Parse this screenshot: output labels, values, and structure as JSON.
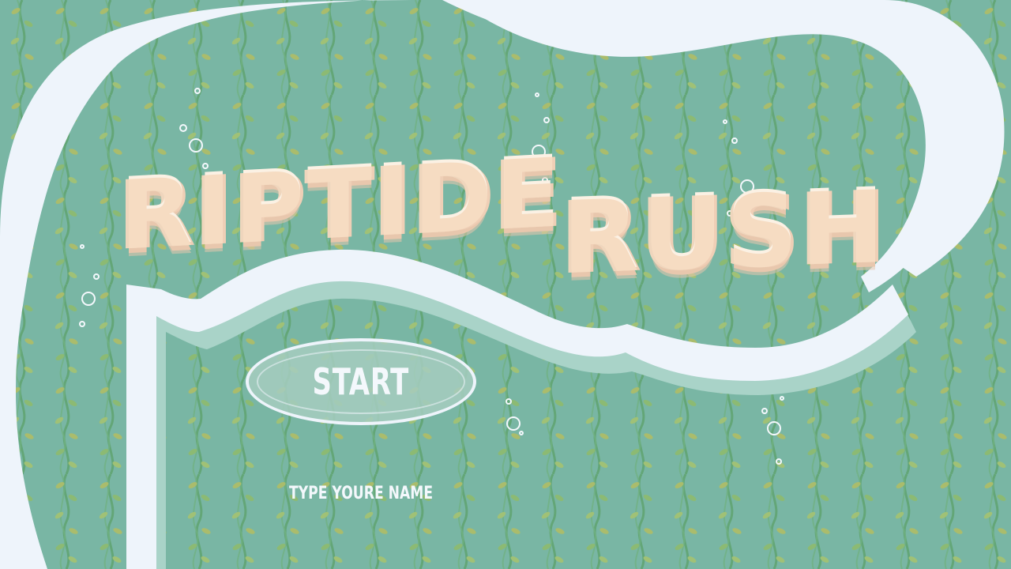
{
  "game": {
    "title_word_1": "RIPTIDE",
    "title_word_2": "RUSH",
    "start_label": "START",
    "name_prompt": "TYPE YOURE NAME"
  },
  "colors": {
    "water": "#79b6a4",
    "foam_path": "#eef4fb",
    "shadow": "#a9d3c8",
    "vine_green": "#5fa36f",
    "leaf_yellow": "#b3bd62",
    "title_sand": "#f6dcc2"
  },
  "icons": {
    "bubbles": "bubble-icon",
    "vines": "seaweed-vine-icon"
  }
}
